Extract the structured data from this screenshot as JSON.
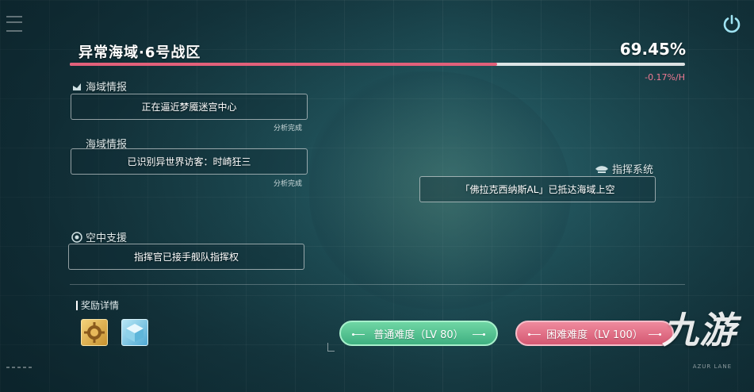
{
  "zone": {
    "title": "异常海域·6号战区",
    "progress_percent": "69.45%",
    "progress_value": 0.6945,
    "progress_rate": "-0.17%/H"
  },
  "intel_1": {
    "title": "海域情报",
    "message": "正在逼近梦魇迷宫中心",
    "status": "分析完成"
  },
  "intel_2": {
    "title": "海域情报",
    "message": "已识别异世界访客：时崎狂三",
    "status": "分析完成"
  },
  "command": {
    "title": "指挥系统",
    "message": "「佛拉克西纳斯AL」已抵达海域上空"
  },
  "air_support": {
    "title": "空中支援",
    "message": "指挥官已接手舰队指挥权"
  },
  "rewards": {
    "title": "奖励详情",
    "items": [
      {
        "icon": "gold-gear-icon"
      },
      {
        "icon": "ice-cube-icon"
      }
    ]
  },
  "buttons": {
    "normal": "普通难度（LV 80）",
    "hard": "困难难度（LV 100）"
  },
  "watermark": {
    "text": "九游",
    "sub": "AZUR LANE"
  },
  "colors": {
    "progress_fill": "#e2607a",
    "rate_text": "#ef7a92",
    "normal_button": "#4fc08e",
    "hard_button": "#e06b82"
  }
}
